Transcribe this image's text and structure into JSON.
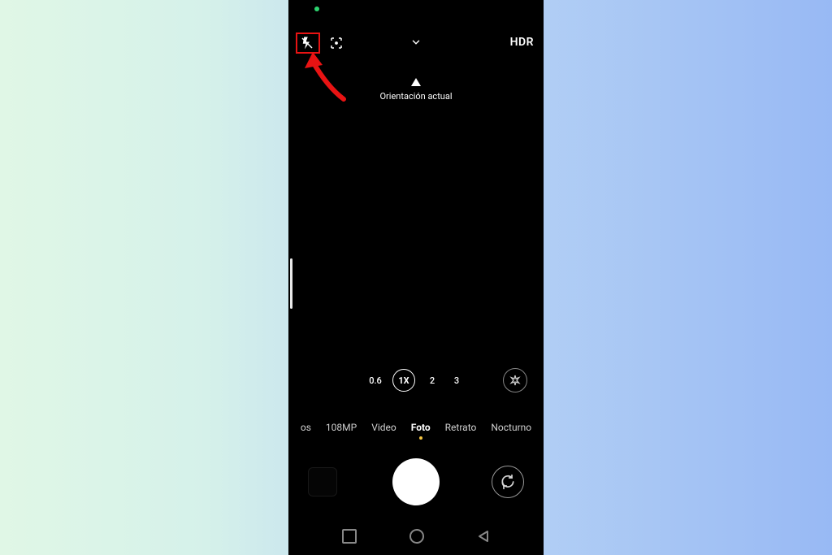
{
  "top": {
    "hdr_label": "HDR"
  },
  "orientation": {
    "label": "Orientación actual"
  },
  "zoom": {
    "levels": [
      "0.6",
      "1X",
      "2",
      "3"
    ],
    "active_index": 1
  },
  "modes": {
    "clipped_left": "os",
    "items": [
      "108MP",
      "Video",
      "Foto",
      "Retrato",
      "Nocturno"
    ],
    "active_index": 2
  },
  "annotation": {
    "highlight_target": "flash-icon",
    "highlight_color": "#e81313"
  }
}
